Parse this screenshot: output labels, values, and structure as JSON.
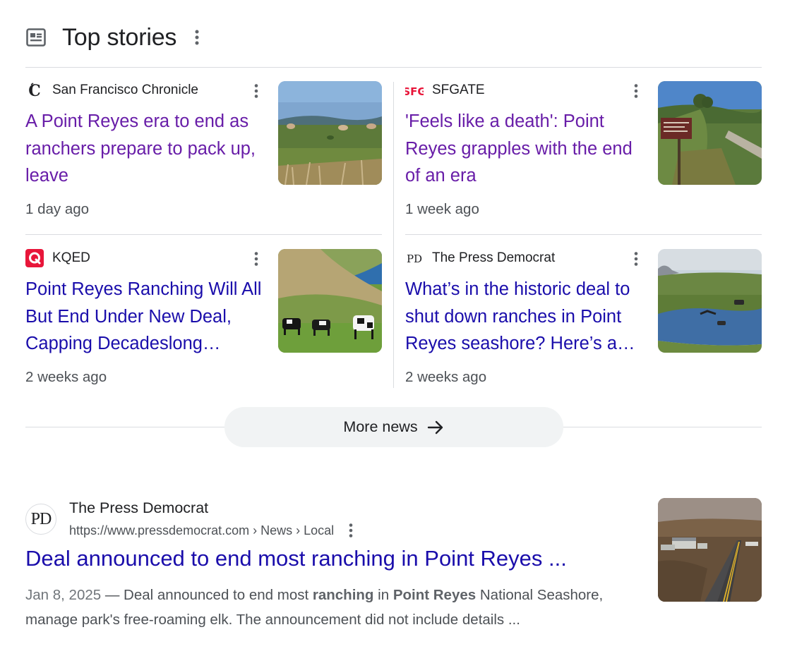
{
  "top_stories": {
    "title": "Top stories",
    "more_news_label": "More news",
    "stories": [
      {
        "source": "San Francisco Chronicle",
        "source_logo": "chronicle-c-logo",
        "headline": "A Point Reyes era to end as ranchers prepare to pack up, leave",
        "time_ago": "1 day ago",
        "visited": true,
        "thumbnail": "grazing cattle on coastal grassland"
      },
      {
        "source": "SFGATE",
        "source_logo": "sfg-logo",
        "logo_text": "SFG",
        "headline": "'Feels like a death': Point Reyes grapples with the end of an era",
        "time_ago": "1 week ago",
        "visited": true,
        "thumbnail": "ranch road with sign on hillside"
      },
      {
        "source": "KQED",
        "source_logo": "kqed-q-logo",
        "headline": "Point Reyes Ranching Will All But End Under New Deal, Capping Decadeslong…",
        "time_ago": "2 weeks ago",
        "visited": false,
        "thumbnail": "black and white cows on green hills by ocean"
      },
      {
        "source": "The Press Democrat",
        "source_logo": "pd-logo",
        "logo_text": "PD",
        "headline": "What’s in the historic deal to shut down ranches in Point Reyes seashore? Here’s a…",
        "time_ago": "2 weeks ago",
        "visited": false,
        "thumbnail": "cattle by a pond on grassland"
      }
    ]
  },
  "result": {
    "favicon_text": "PD",
    "site_name": "The Press Democrat",
    "url": "https://www.pressdemocrat.com › News › Local",
    "title": "Deal announced to end most ranching in Point Reyes ...",
    "date": "Jan 8, 2025",
    "snippet_parts": {
      "p1": " — Deal announced to end most ",
      "b1": "ranching",
      "p2": " in ",
      "b2": "Point Reyes",
      "p3": " National Seashore, manage park's free-roaming elk. The announcement did not include details ..."
    },
    "thumbnail": "road through ranch buildings in dry hills"
  },
  "colors": {
    "visited_link": "#681da8",
    "link": "#1a0dab",
    "kqed_red": "#e8163a",
    "sfg_red": "#e8163a"
  }
}
